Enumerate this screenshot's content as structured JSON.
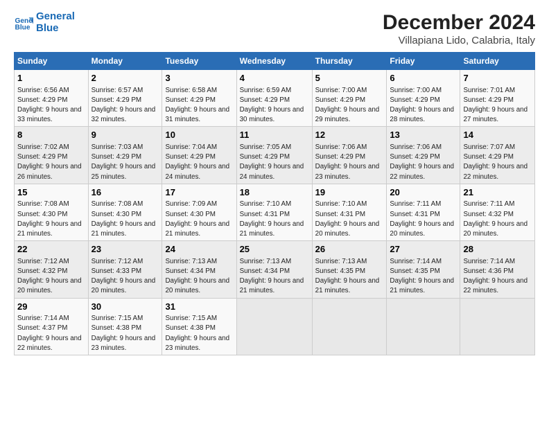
{
  "logo": {
    "line1": "General",
    "line2": "Blue"
  },
  "title": "December 2024",
  "subtitle": "Villapiana Lido, Calabria, Italy",
  "headers": [
    "Sunday",
    "Monday",
    "Tuesday",
    "Wednesday",
    "Thursday",
    "Friday",
    "Saturday"
  ],
  "weeks": [
    [
      {
        "day": "1",
        "sunrise": "6:56 AM",
        "sunset": "4:29 PM",
        "daylight": "9 hours and 33 minutes."
      },
      {
        "day": "2",
        "sunrise": "6:57 AM",
        "sunset": "4:29 PM",
        "daylight": "9 hours and 32 minutes."
      },
      {
        "day": "3",
        "sunrise": "6:58 AM",
        "sunset": "4:29 PM",
        "daylight": "9 hours and 31 minutes."
      },
      {
        "day": "4",
        "sunrise": "6:59 AM",
        "sunset": "4:29 PM",
        "daylight": "9 hours and 30 minutes."
      },
      {
        "day": "5",
        "sunrise": "7:00 AM",
        "sunset": "4:29 PM",
        "daylight": "9 hours and 29 minutes."
      },
      {
        "day": "6",
        "sunrise": "7:00 AM",
        "sunset": "4:29 PM",
        "daylight": "9 hours and 28 minutes."
      },
      {
        "day": "7",
        "sunrise": "7:01 AM",
        "sunset": "4:29 PM",
        "daylight": "9 hours and 27 minutes."
      }
    ],
    [
      {
        "day": "8",
        "sunrise": "7:02 AM",
        "sunset": "4:29 PM",
        "daylight": "9 hours and 26 minutes."
      },
      {
        "day": "9",
        "sunrise": "7:03 AM",
        "sunset": "4:29 PM",
        "daylight": "9 hours and 25 minutes."
      },
      {
        "day": "10",
        "sunrise": "7:04 AM",
        "sunset": "4:29 PM",
        "daylight": "9 hours and 24 minutes."
      },
      {
        "day": "11",
        "sunrise": "7:05 AM",
        "sunset": "4:29 PM",
        "daylight": "9 hours and 24 minutes."
      },
      {
        "day": "12",
        "sunrise": "7:06 AM",
        "sunset": "4:29 PM",
        "daylight": "9 hours and 23 minutes."
      },
      {
        "day": "13",
        "sunrise": "7:06 AM",
        "sunset": "4:29 PM",
        "daylight": "9 hours and 22 minutes."
      },
      {
        "day": "14",
        "sunrise": "7:07 AM",
        "sunset": "4:29 PM",
        "daylight": "9 hours and 22 minutes."
      }
    ],
    [
      {
        "day": "15",
        "sunrise": "7:08 AM",
        "sunset": "4:30 PM",
        "daylight": "9 hours and 21 minutes."
      },
      {
        "day": "16",
        "sunrise": "7:08 AM",
        "sunset": "4:30 PM",
        "daylight": "9 hours and 21 minutes."
      },
      {
        "day": "17",
        "sunrise": "7:09 AM",
        "sunset": "4:30 PM",
        "daylight": "9 hours and 21 minutes."
      },
      {
        "day": "18",
        "sunrise": "7:10 AM",
        "sunset": "4:31 PM",
        "daylight": "9 hours and 21 minutes."
      },
      {
        "day": "19",
        "sunrise": "7:10 AM",
        "sunset": "4:31 PM",
        "daylight": "9 hours and 20 minutes."
      },
      {
        "day": "20",
        "sunrise": "7:11 AM",
        "sunset": "4:31 PM",
        "daylight": "9 hours and 20 minutes."
      },
      {
        "day": "21",
        "sunrise": "7:11 AM",
        "sunset": "4:32 PM",
        "daylight": "9 hours and 20 minutes."
      }
    ],
    [
      {
        "day": "22",
        "sunrise": "7:12 AM",
        "sunset": "4:32 PM",
        "daylight": "9 hours and 20 minutes."
      },
      {
        "day": "23",
        "sunrise": "7:12 AM",
        "sunset": "4:33 PM",
        "daylight": "9 hours and 20 minutes."
      },
      {
        "day": "24",
        "sunrise": "7:13 AM",
        "sunset": "4:34 PM",
        "daylight": "9 hours and 20 minutes."
      },
      {
        "day": "25",
        "sunrise": "7:13 AM",
        "sunset": "4:34 PM",
        "daylight": "9 hours and 21 minutes."
      },
      {
        "day": "26",
        "sunrise": "7:13 AM",
        "sunset": "4:35 PM",
        "daylight": "9 hours and 21 minutes."
      },
      {
        "day": "27",
        "sunrise": "7:14 AM",
        "sunset": "4:35 PM",
        "daylight": "9 hours and 21 minutes."
      },
      {
        "day": "28",
        "sunrise": "7:14 AM",
        "sunset": "4:36 PM",
        "daylight": "9 hours and 22 minutes."
      }
    ],
    [
      {
        "day": "29",
        "sunrise": "7:14 AM",
        "sunset": "4:37 PM",
        "daylight": "9 hours and 22 minutes."
      },
      {
        "day": "30",
        "sunrise": "7:15 AM",
        "sunset": "4:38 PM",
        "daylight": "9 hours and 23 minutes."
      },
      {
        "day": "31",
        "sunrise": "7:15 AM",
        "sunset": "4:38 PM",
        "daylight": "9 hours and 23 minutes."
      },
      null,
      null,
      null,
      null
    ]
  ],
  "labels": {
    "sunrise": "Sunrise:",
    "sunset": "Sunset:",
    "daylight": "Daylight:"
  }
}
